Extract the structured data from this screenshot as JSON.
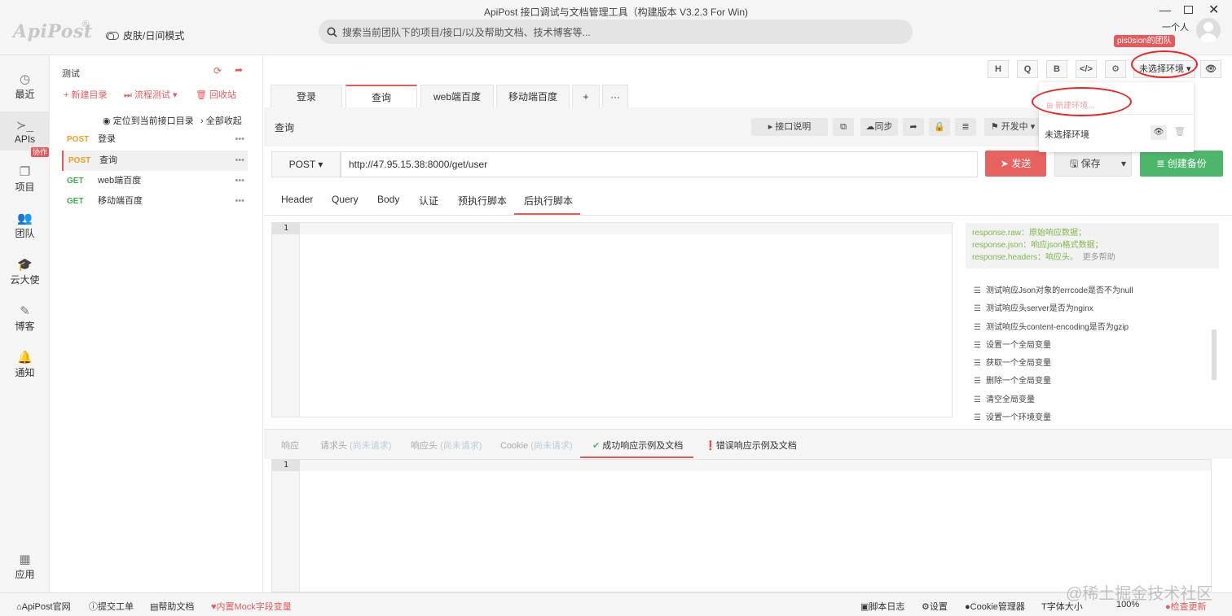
{
  "app_title": "ApiPost 接口调试与文档管理工具（构建版本 V3.2.3 For Win)",
  "logo_text": "ApiPost",
  "logo_reg": "®",
  "skin_toggle": "皮肤/日间模式",
  "search_placeholder": "搜索当前团队下的项目/接口/以及帮助文档、技术博客等...",
  "window": {
    "minimize": "—",
    "close": "✕"
  },
  "user": {
    "name": "一个人",
    "team_badge": "pis0sion的团队"
  },
  "nav": [
    {
      "label": "最近",
      "icon": "clock-icon",
      "glyph": "◷"
    },
    {
      "label": "APIs",
      "icon": "terminal-icon",
      "glyph": "≻_"
    },
    {
      "label": "项目",
      "icon": "folders-icon",
      "glyph": "❐"
    },
    {
      "label": "团队",
      "icon": "users-icon",
      "glyph": "👥"
    },
    {
      "label": "云大使",
      "icon": "graduation-cap-icon",
      "glyph": "🎓"
    },
    {
      "label": "博客",
      "icon": "edit-icon",
      "glyph": "✎"
    },
    {
      "label": "通知",
      "icon": "bell-icon",
      "glyph": "🔔"
    },
    {
      "label": "应用",
      "icon": "apps-grid-icon",
      "glyph": "▦"
    }
  ],
  "nav_collab_badge": "协作",
  "tree": {
    "title": "测试",
    "new_dir": "+ 新建目录",
    "flow_test": "⏭ 流程测试 ▾",
    "recycle": "🗑 回收站",
    "locate": "定位到当前接口目录",
    "collapse_all": "› 全部收起",
    "items": [
      {
        "method": "POST",
        "name": "登录"
      },
      {
        "method": "POST",
        "name": "查询"
      },
      {
        "method": "GET",
        "name": "web端百度"
      },
      {
        "method": "GET",
        "name": "移动端百度"
      }
    ]
  },
  "toolbar": {
    "h": "H",
    "q": "Q",
    "b": "B",
    "code": "</>",
    "settings": "⚙",
    "env": "未选择环境 ▾",
    "eye": "👁"
  },
  "tabs": [
    {
      "label": "登录"
    },
    {
      "label": "查询"
    },
    {
      "label": "web端百度"
    },
    {
      "label": "移动端百度"
    },
    {
      "label": "+"
    },
    {
      "label": "···"
    }
  ],
  "request": {
    "name": "查询",
    "doc_btn": "▸ 接口说明",
    "sync_btn": "☁同步",
    "status_btn": "⚑ 开发中 ▾",
    "method": "POST ▾",
    "url": "http://47.95.15.38:8000/get/user",
    "send": "发送",
    "save": "保存",
    "backup": "创建备份"
  },
  "sub_tabs": [
    "Header",
    "Query",
    "Body",
    "认证",
    "预执行脚本",
    "后执行脚本"
  ],
  "editor_line": "1",
  "hints": [
    "response.raw：原始响应数据；",
    "response.json：响应json格式数据；",
    "response.headers：响应头。"
  ],
  "hints_more": "更多帮助",
  "snippets": [
    "测试响应Json对象的errcode是否不为null",
    "测试响应头server是否为nginx",
    "测试响应头content-encoding是否为gzip",
    "设置一个全局变量",
    "获取一个全局变量",
    "删除一个全局变量",
    "清空全局变量",
    "设置一个环境变量"
  ],
  "resp_tabs": {
    "resp": "响应",
    "req_headers": "请求头",
    "resp_headers": "响应头",
    "cookie": "Cookie",
    "not_requested": "(尚未请求)",
    "success": "成功响应示例及文档",
    "error": "错误响应示例及文档"
  },
  "env_dropdown": {
    "new_env": "新建环境...",
    "option": "未选择环境"
  },
  "statusbar": {
    "official": "ApiPost官网",
    "ticket": "提交工单",
    "help": "帮助文档",
    "mock": "内置Mock字段变量",
    "log": "脚本日志",
    "settings": "设置",
    "cookie": "Cookie管理器",
    "font": "字体大小",
    "zoom": "100%",
    "update": "检查更新"
  },
  "watermark": "@稀土掘金技术社区",
  "colors": {
    "accent": "#e55b5b",
    "post": "#f0a020",
    "get": "#3fae4a",
    "send": "#e8625f",
    "backup": "#4cb76a"
  }
}
